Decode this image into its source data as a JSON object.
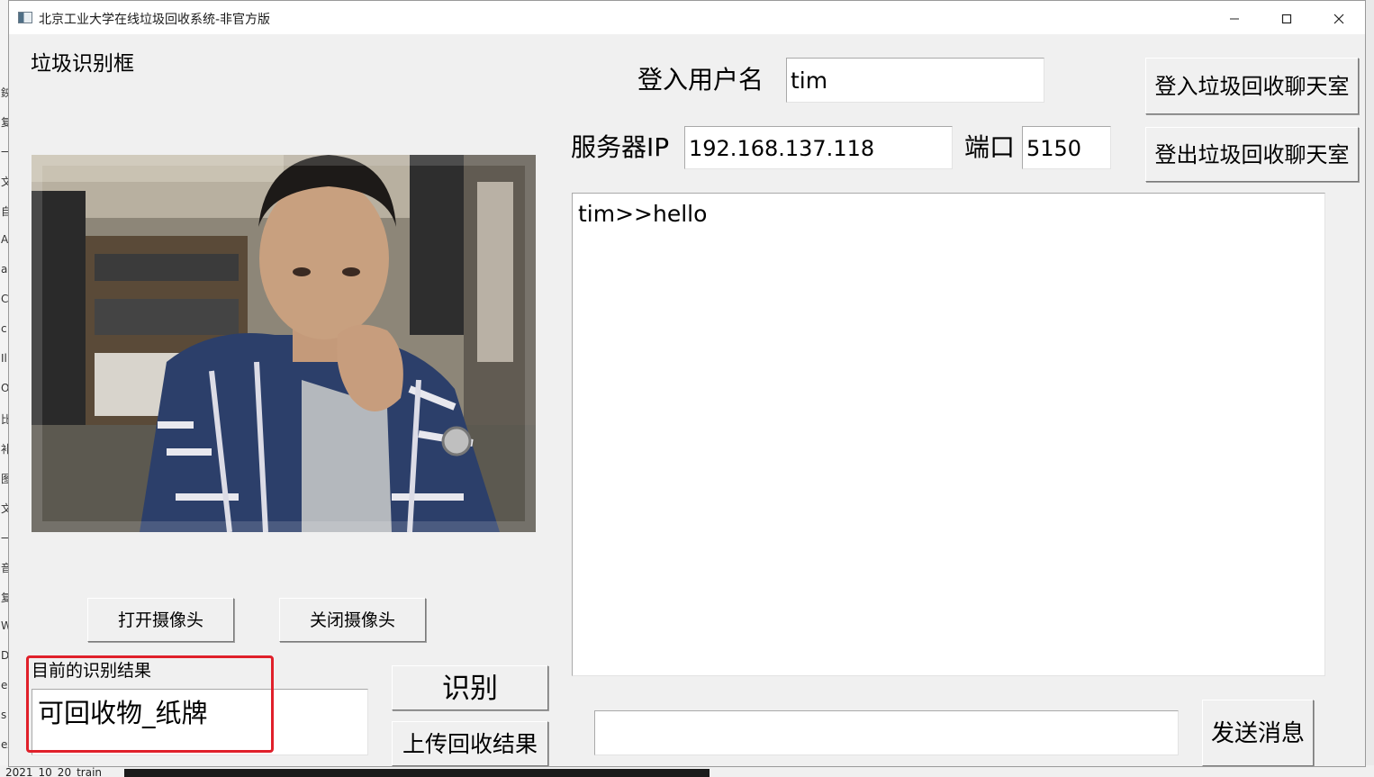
{
  "background": {
    "left_chars": [
      "鉠",
      "复",
      "一",
      "文",
      "自",
      "A",
      "a",
      "C",
      "c",
      "Il",
      "Or",
      "比",
      "补",
      "图",
      "文",
      "一",
      "音",
      "复",
      "W",
      "D",
      "e",
      "s",
      "ex"
    ],
    "bottom_text": "2021_10_20_train"
  },
  "window": {
    "title": "北京工业大学在线垃圾回收系统-非官方版",
    "controls": {
      "minimize": "—",
      "maximize": "☐",
      "close": "✕"
    }
  },
  "left_panel": {
    "frame_label": "垃圾识别框",
    "open_camera_label": "打开摄像头",
    "close_camera_label": "关闭摄像头",
    "result_label": "目前的识别结果",
    "result_value": "可回收物_纸牌",
    "recognize_label": "识别",
    "upload_label": "上传回收结果"
  },
  "right_panel": {
    "username_label": "登入用户名",
    "username_value": "tim",
    "server_ip_label": "服务器IP",
    "server_ip_value": "192.168.137.118",
    "port_label": "端口",
    "port_value": "5150",
    "login_label": "登入垃圾回收聊天室",
    "logout_label": "登出垃圾回收聊天室",
    "chat_log": "tim>>hello",
    "message_value": "",
    "send_label": "发送消息"
  },
  "colors": {
    "window_bg": "#f0f0f0",
    "highlight_box": "#e0202a"
  }
}
